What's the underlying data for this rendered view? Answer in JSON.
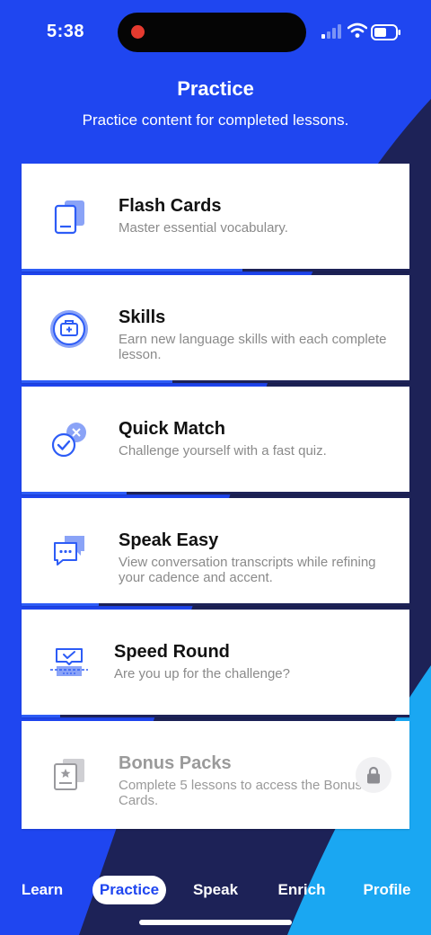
{
  "status_bar": {
    "time": "5:38"
  },
  "header": {
    "title": "Practice",
    "subtitle": "Practice content for completed lessons."
  },
  "colors": {
    "brand_blue": "#1f46f0",
    "navy": "#1d2257",
    "cyan": "#1aa7f2",
    "icon_blue": "#2d5cf6",
    "icon_light": "#8aa3f7"
  },
  "cards": [
    {
      "title": "Flash Cards",
      "description": "Master essential vocabulary.",
      "icon": "flash-cards-icon",
      "progress": 0.57,
      "locked": false
    },
    {
      "title": "Skills",
      "description": "Earn new language skills with each complete lesson.",
      "icon": "skills-briefcase-icon",
      "progress": 0.39,
      "locked": false
    },
    {
      "title": "Quick Match",
      "description": "Challenge yourself with a fast quiz.",
      "icon": "quick-match-icon",
      "progress": 0.27,
      "locked": false
    },
    {
      "title": "Speak Easy",
      "description": "View conversation transcripts while refining your cadence and accent.",
      "icon": "speech-bubbles-icon",
      "progress": 0.2,
      "locked": false
    },
    {
      "title": "Speed Round",
      "description": "Are you up for the challenge?",
      "icon": "speed-round-icon",
      "progress": 0.1,
      "locked": false
    },
    {
      "title": "Bonus Packs",
      "description": "Complete 5 lessons to access the Bonus Cards.",
      "icon": "bonus-packs-icon",
      "progress": 0,
      "locked": true
    }
  ],
  "tabs": [
    {
      "label": "Learn",
      "active": false
    },
    {
      "label": "Practice",
      "active": true
    },
    {
      "label": "Speak",
      "active": false
    },
    {
      "label": "Enrich",
      "active": false
    },
    {
      "label": "Profile",
      "active": false
    }
  ]
}
